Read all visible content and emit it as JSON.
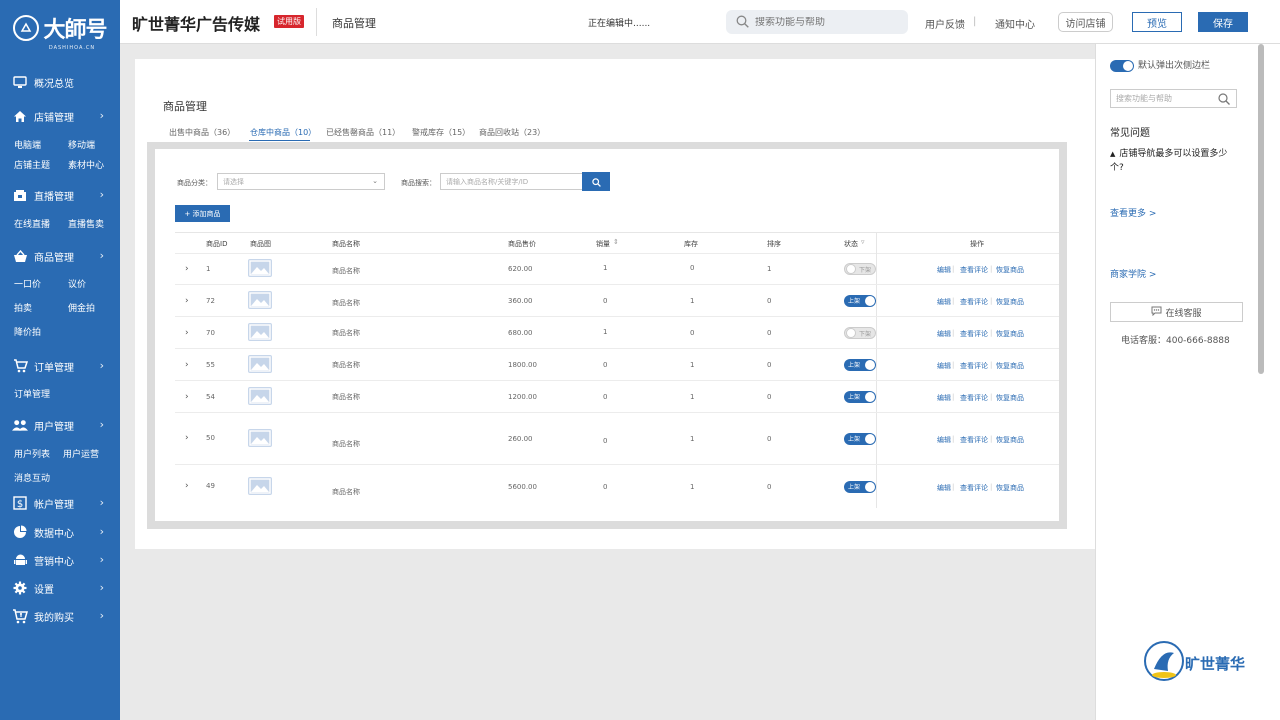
{
  "sidebar": {
    "logo_text": "大師号",
    "logo_sub": "DASHIHOA.CN",
    "nav": [
      {
        "label": "概况总览",
        "icon": "monitor-icon",
        "expandable": false
      },
      {
        "label": "店铺管理",
        "icon": "home-icon",
        "expandable": true,
        "subs": [
          "电脑端",
          "移动端",
          "店铺主题",
          "素材中心"
        ]
      },
      {
        "label": "直播管理",
        "icon": "live-icon",
        "expandable": true,
        "subs": [
          "在线直播",
          "直播售卖"
        ]
      },
      {
        "label": "商品管理",
        "icon": "basket-icon",
        "expandable": true,
        "subs": [
          "一口价",
          "议价",
          "拍卖",
          "佣金拍",
          "降价拍"
        ]
      },
      {
        "label": "订单管理",
        "icon": "cart-icon",
        "expandable": true,
        "subs": [
          "订单管理"
        ]
      },
      {
        "label": "用户管理",
        "icon": "users-icon",
        "expandable": true,
        "subs": [
          "用户列表",
          "用户运营",
          "消息互动"
        ]
      },
      {
        "label": "帐户管理",
        "icon": "dollar-icon",
        "expandable": true
      },
      {
        "label": "数据中心",
        "icon": "pie-chart-icon",
        "expandable": true
      },
      {
        "label": "营销中心",
        "icon": "android-icon",
        "expandable": true
      },
      {
        "label": "设置",
        "icon": "gear-icon",
        "expandable": true
      },
      {
        "label": "我的购买",
        "icon": "shopping-cart-icon",
        "expandable": true
      }
    ]
  },
  "header": {
    "brand": "旷世菁华广告传媒",
    "trial": "试用版",
    "page_name": "商品管理",
    "editing": "正在编辑中......",
    "search_placeholder": "搜索功能与帮助",
    "feedback": "用户反馈",
    "separator": "|",
    "notifications": "通知中心",
    "visit_store": "访问店铺",
    "preview": "预览",
    "save": "保存"
  },
  "main": {
    "title": "商品管理",
    "tabs": [
      "出售中商品（36）",
      "仓库中商品（10）",
      "已经售罄商品（11）",
      "警戒库存（15）",
      "商品回收站（23）"
    ],
    "active_tab": 1,
    "filter": {
      "category_label": "商品分类：",
      "category_placeholder": "请选择",
      "search_label": "商品搜索：",
      "search_placeholder": "请输入商品名称/关键字/ID"
    },
    "add_button": "+ 添加商品",
    "columns": {
      "id": "商品ID",
      "image": "商品图",
      "name": "商品名称",
      "price": "商品售价",
      "sales": "销量",
      "stock": "库存",
      "sort": "排序",
      "status": "状态",
      "ops": "操作"
    },
    "status_labels": {
      "on": "上架",
      "off": "下架"
    },
    "ops_labels": [
      "编辑",
      "查看评论",
      "恢复商品"
    ],
    "rows": [
      {
        "id": "1",
        "name": "商品名称",
        "price": "620.00",
        "sales": "1",
        "stock": "0",
        "sort": "1",
        "status": "off"
      },
      {
        "id": "72",
        "name": "商品名称",
        "price": "360.00",
        "sales": "0",
        "stock": "1",
        "sort": "0",
        "status": "on"
      },
      {
        "id": "70",
        "name": "商品名称",
        "price": "680.00",
        "sales": "1",
        "stock": "0",
        "sort": "0",
        "status": "off"
      },
      {
        "id": "55",
        "name": "商品名称",
        "price": "1800.00",
        "sales": "0",
        "stock": "1",
        "sort": "0",
        "status": "on"
      },
      {
        "id": "54",
        "name": "商品名称",
        "price": "1200.00",
        "sales": "0",
        "stock": "1",
        "sort": "0",
        "status": "on"
      },
      {
        "id": "50",
        "name": "商品名称",
        "price": "260.00",
        "sales": "0",
        "stock": "1",
        "sort": "0",
        "status": "on"
      },
      {
        "id": "49",
        "name": "商品名称",
        "price": "5600.00",
        "sales": "0",
        "stock": "1",
        "sort": "0",
        "status": "on"
      }
    ]
  },
  "right_panel": {
    "default_popup": "默认弹出次侧边栏",
    "search_placeholder": "搜索功能与帮助",
    "faq_title": "常见问题",
    "faq_item": "店铺导航最多可以设置多少个?",
    "more": "查看更多 >",
    "academy": "商家学院 >",
    "online_service": "在线客服",
    "phone": "电话客服：400-666-8888",
    "logo_text": "旷世菁华"
  },
  "colors": {
    "primary": "#2a6bb3",
    "trial_badge": "#d7262d"
  }
}
